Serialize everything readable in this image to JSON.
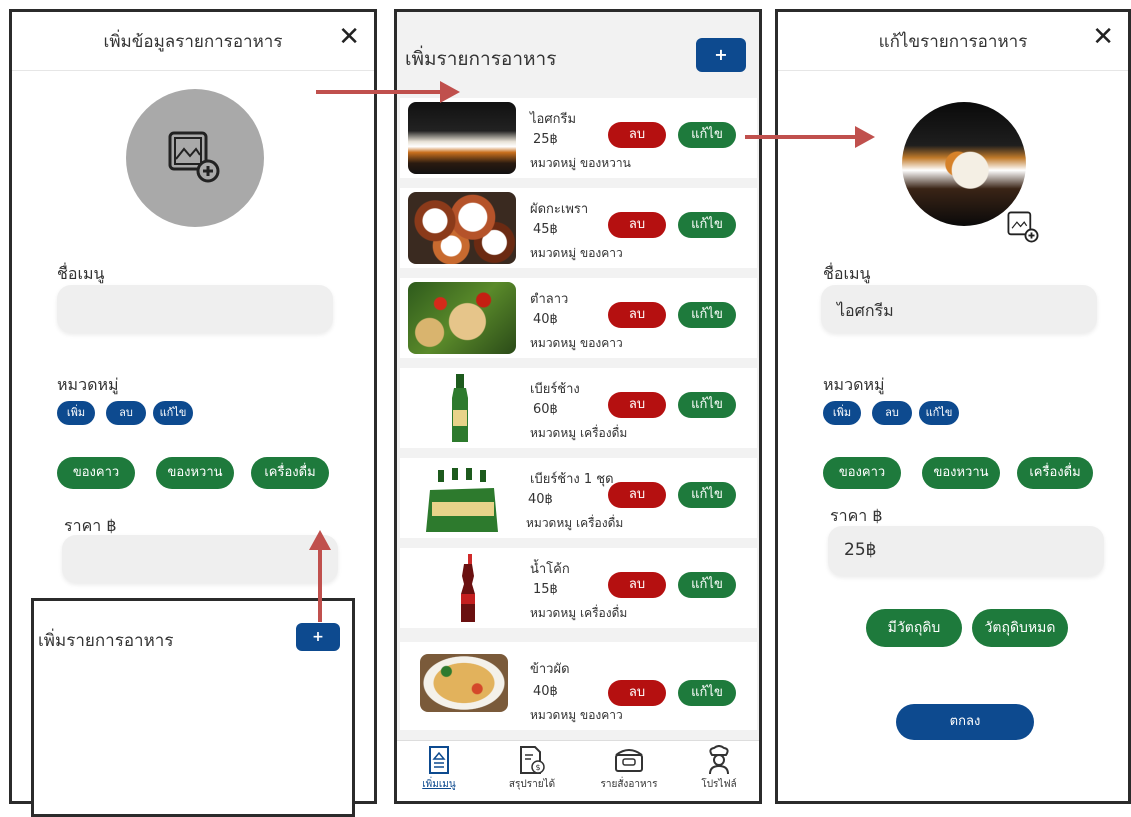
{
  "colors": {
    "primary_blue": "#0d4a8f",
    "delete_red": "#b51010",
    "edit_green": "#1e7a3c",
    "arrow_red": "#c0504d"
  },
  "add_dialog": {
    "title": "เพิ่มข้อมูลรายการอาหาร",
    "name_label": "ชื่อเมนู",
    "category_label": "หมวดหมู่",
    "chip_add": "เพิ่ม",
    "chip_delete": "ลบ",
    "chip_edit": "แก้ไข",
    "categories": [
      "ของคาว",
      "ของหวาน",
      "เครื่องดื่ม"
    ],
    "price_label": "ราคา ฿"
  },
  "sub_panel": {
    "title": "เพิ่มรายการอาหาร",
    "add_label": "+"
  },
  "menu_list": {
    "title": "เพิ่มรายการอาหาร",
    "add_label": "+",
    "delete_label": "ลบ",
    "edit_label": "แก้ไข",
    "items": [
      {
        "name": "ไอศกรีม",
        "price": "25฿",
        "category": "หมวดหมู่  ของหวาน"
      },
      {
        "name": "ผัดกะเพรา",
        "price": "45฿",
        "category": "หมวดหมู่  ของคาว"
      },
      {
        "name": "ตำลาว",
        "price": "40฿",
        "category": "หมวดหมู  ของคาว"
      },
      {
        "name": "เบียร์ช้าง",
        "price": "60฿",
        "category": "หมวดหมู  เครื่องดื่ม"
      },
      {
        "name": "เบียร์ช้าง 1 ชุด",
        "price": "40฿",
        "category": "หมวดหมู  เครื่องดื่ม"
      },
      {
        "name": "น้ำโค้ก",
        "price": "15฿",
        "category": "หมวดหมู เครื่องดื่ม"
      },
      {
        "name": "ข้าวผัด",
        "price": "40฿",
        "category": "หมวดหมู  ของคาว"
      }
    ],
    "nav": [
      {
        "label": "เพิ่มเมนู",
        "icon": "menu-doc-icon"
      },
      {
        "label": "สรุปรายได้",
        "icon": "income-doc-icon"
      },
      {
        "label": "รายสั่งอาหาร",
        "icon": "food-box-icon"
      },
      {
        "label": "โปรไฟล์",
        "icon": "chef-icon"
      }
    ]
  },
  "edit_dialog": {
    "title": "แก้ไขรายการอาหาร",
    "name_label": "ชื่อเมนู",
    "name_value": "ไอศกรีม",
    "category_label": "หมวดหมู่",
    "chip_add": "เพิ่ม",
    "chip_delete": "ลบ",
    "chip_edit": "แก้ไข",
    "categories": [
      "ของคาว",
      "ของหวาน",
      "เครื่องดื่ม"
    ],
    "price_label": "ราคา ฿",
    "price_value": "25฿",
    "in_stock_label": "มีวัตถุดิบ",
    "out_of_stock_label": "วัตถุดิบหมด",
    "ok_label": "ตกลง"
  }
}
